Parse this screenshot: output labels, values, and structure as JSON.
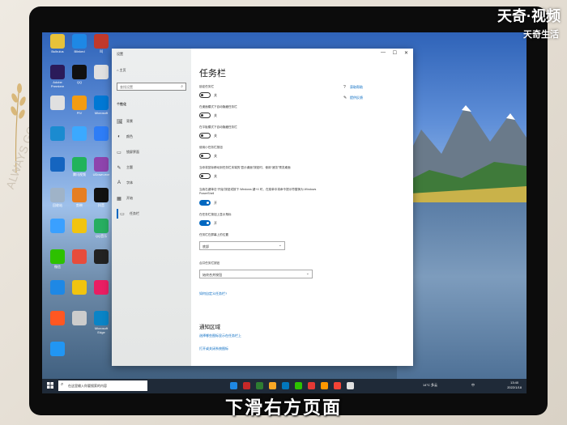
{
  "watermark": {
    "brand": "天奇·视频",
    "sub": "天奇生活"
  },
  "subtitle": "下滑右方页面",
  "deco_text": "ALWAYS GO",
  "desktop_icons": [
    {
      "label": "Bulbulus",
      "color": "#e7c23a"
    },
    {
      "label": "Blinked",
      "color": "#1e88e5"
    },
    {
      "label": "叫",
      "color": "#c0392b"
    },
    {
      "label": "Adobe Premiere",
      "color": "#2b1b5a"
    },
    {
      "label": "QQ",
      "color": "#111111"
    },
    {
      "label": "",
      "color": "#e0e0e0"
    },
    {
      "label": "",
      "color": "#e0e0e0"
    },
    {
      "label": "PIV",
      "color": "#f39c12"
    },
    {
      "label": "Microsoft",
      "color": "#0078d4"
    },
    {
      "label": "",
      "color": "#1b8bd0"
    },
    {
      "label": "",
      "color": "#3ba9ff"
    },
    {
      "label": "",
      "color": "#2e7df6"
    },
    {
      "label": "",
      "color": "#1565c0"
    },
    {
      "label": "腾讯视频",
      "color": "#21b35b"
    },
    {
      "label": "UDown.exe",
      "color": "#8e44ad"
    },
    {
      "label": "回收站",
      "color": "#9fb3c8"
    },
    {
      "label": "剪映",
      "color": "#e67e22"
    },
    {
      "label": "抖音",
      "color": "#111111"
    },
    {
      "label": "",
      "color": "#3aa0ff"
    },
    {
      "label": "",
      "color": "#f1c40f"
    },
    {
      "label": "QQ音乐",
      "color": "#27ae60"
    },
    {
      "label": "微信",
      "color": "#2dc100"
    },
    {
      "label": "",
      "color": "#e74c3c"
    },
    {
      "label": "",
      "color": "#222222"
    },
    {
      "label": "",
      "color": "#1e88e5"
    },
    {
      "label": "",
      "color": "#f1c40f"
    },
    {
      "label": "",
      "color": "#e91e63"
    },
    {
      "label": "",
      "color": "#ff5722"
    },
    {
      "label": "",
      "color": "#cccccc"
    },
    {
      "label": "Microsoft Edge",
      "color": "#0a84c6"
    },
    {
      "label": "",
      "color": "#2196f3"
    }
  ],
  "window": {
    "title": "设置",
    "controls": [
      "—",
      "☐",
      "✕"
    ]
  },
  "nav": {
    "home": "主页",
    "search_placeholder": "查找设置",
    "section": "个性化",
    "items": [
      {
        "label": "背景",
        "icon": "🖼"
      },
      {
        "label": "颜色",
        "icon": "◐"
      },
      {
        "label": "锁屏界面",
        "icon": "▭"
      },
      {
        "label": "主题",
        "icon": "✎"
      },
      {
        "label": "字体",
        "icon": "A"
      },
      {
        "label": "开始",
        "icon": "▦"
      },
      {
        "label": "任务栏",
        "icon": "▭",
        "active": true
      }
    ]
  },
  "content": {
    "title": "任务栏",
    "settings": [
      {
        "label": "锁定任务栏",
        "state": "关",
        "on": false
      },
      {
        "label": "在桌面模式下自动隐藏任务栏",
        "state": "关",
        "on": false
      },
      {
        "label": "在平板模式下自动隐藏任务栏",
        "state": "关",
        "on": false
      },
      {
        "label": "使用小任务栏按钮",
        "state": "关",
        "on": false
      },
      {
        "label": "当你将鼠标移动到任务栏末端的“显示桌面”按钮时，使用“速览”预览桌面",
        "state": "关",
        "on": false
      },
      {
        "label": "当我右键单击“开始”按钮或按下 Windows 键+X 时，在菜单中将命令提示符替换为 Windows PowerShell",
        "state": "开",
        "on": true
      },
      {
        "label": "在任务栏按钮上显示角标",
        "state": "开",
        "on": true
      }
    ],
    "position_label": "任务栏在屏幕上的位置",
    "position_value": "底部",
    "combine_label": "合并任务栏按钮",
    "combine_value": "始终合并按钮",
    "customize_link": "如何自定义任务栏?",
    "notification_title": "通知区域",
    "notification_link1": "选择哪些图标显示在任务栏上",
    "notification_link2": "打开或关闭系统图标",
    "right_links": [
      {
        "label": "获取帮助",
        "icon": "?"
      },
      {
        "label": "提供反馈",
        "icon": "✎"
      }
    ]
  },
  "taskbar": {
    "search_placeholder": "在这里输入你要搜索的内容",
    "tray_weather": "14°C 多云",
    "tray_lang": "中",
    "clock_time": "13:40",
    "clock_date": "2022/1/18",
    "apps": [
      "#1e88e5",
      "#c62828",
      "#2e7d32",
      "#f9a825",
      "#0277bd",
      "#2dc100",
      "#e53935",
      "#ff9800",
      "#f44336",
      "#e0e0e0"
    ]
  }
}
